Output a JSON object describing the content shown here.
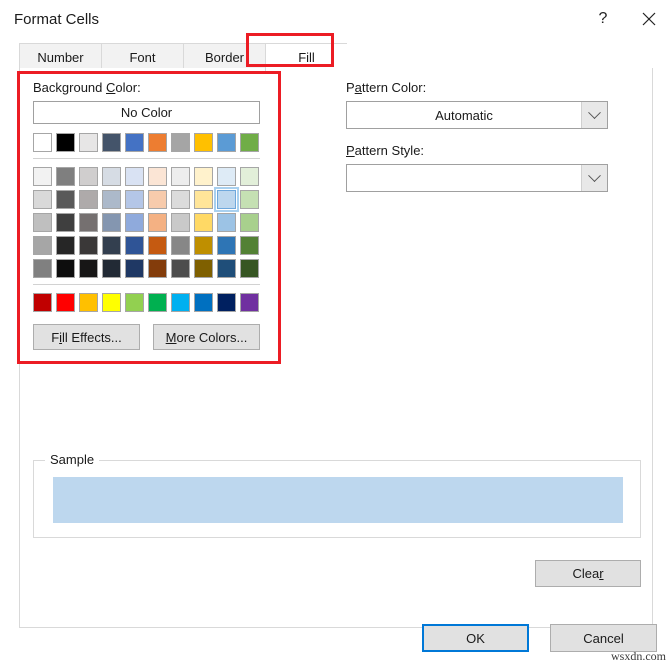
{
  "window": {
    "title": "Format Cells",
    "help_icon": "question-mark-icon",
    "close_icon": "close-icon"
  },
  "tabs": [
    {
      "label": "Number",
      "selected": false
    },
    {
      "label": "Font",
      "selected": false
    },
    {
      "label": "Border",
      "selected": false
    },
    {
      "label": "Fill",
      "selected": true
    }
  ],
  "background_color": {
    "label_before": "Background ",
    "label_accel": "C",
    "label_after": "olor:",
    "no_color_label": "No Color",
    "theme_row": [
      "#FFFFFF",
      "#000000",
      "#E7E6E6",
      "#44546A",
      "#4472C4",
      "#ED7D31",
      "#A5A5A5",
      "#FFC000",
      "#5B9BD5",
      "#70AD47"
    ],
    "tint_rows": [
      [
        "#F2F2F2",
        "#7F7F7F",
        "#D0CECE",
        "#D6DCE4",
        "#D9E2F3",
        "#FBE5D5",
        "#EDEDED",
        "#FFF2CC",
        "#DEEBF6",
        "#E2EFD9"
      ],
      [
        "#D9D9D9",
        "#595959",
        "#AEAAAA",
        "#ACB9CA",
        "#B4C6E7",
        "#F7CBAC",
        "#DBDBDB",
        "#FFE599",
        "#BDD7EE",
        "#C5E0B3"
      ],
      [
        "#BFBFBF",
        "#3F3F3F",
        "#757070",
        "#8496B0",
        "#8FAADC",
        "#F4B183",
        "#C9C9C9",
        "#FFD965",
        "#9CC3E5",
        "#A8D08D"
      ],
      [
        "#A6A6A6",
        "#262626",
        "#3A3838",
        "#333F4F",
        "#2F5496",
        "#C55A11",
        "#878787",
        "#BF8F00",
        "#2E75B5",
        "#538135"
      ],
      [
        "#808080",
        "#0D0D0D",
        "#171616",
        "#222A35",
        "#1F3864",
        "#833C0B",
        "#4D4D4D",
        "#7F6000",
        "#1F4E79",
        "#375623"
      ]
    ],
    "selected_row": 1,
    "selected_col": 8,
    "standard_row": [
      "#C00000",
      "#FF0000",
      "#FFC000",
      "#FFFF00",
      "#92D050",
      "#00B050",
      "#00B0F0",
      "#0070C0",
      "#002060",
      "#7030A0"
    ],
    "fill_effects_before": "F",
    "fill_effects_accel": "i",
    "fill_effects_after": "ll Effects...",
    "more_colors_accel": "M",
    "more_colors_after": "ore Colors..."
  },
  "pattern_color": {
    "label_before": "P",
    "label_accel": "a",
    "label_after": "ttern Color:",
    "value": "Automatic",
    "arrow_icon": "chevron-down-icon"
  },
  "pattern_style": {
    "label_accel": "P",
    "label_after": "attern Style:",
    "value": "",
    "arrow_icon": "chevron-down-icon"
  },
  "sample": {
    "legend": "Sample",
    "fill_color": "#BDD7EE"
  },
  "buttons": {
    "clear_before": "Clea",
    "clear_accel": "r",
    "ok": "OK",
    "cancel": "Cancel"
  },
  "annotations": {
    "accent_color": "#EC1C24"
  },
  "watermark": "wsxdn.com"
}
